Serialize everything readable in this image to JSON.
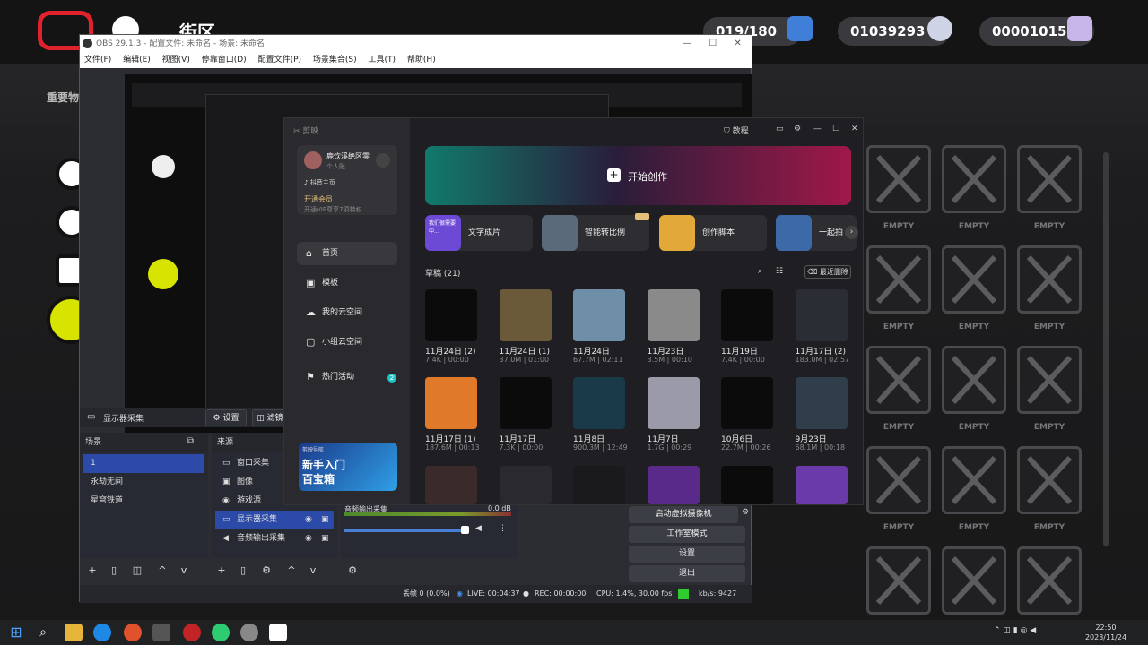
{
  "game": {
    "counter1": "019/180",
    "counter2": "01039293",
    "counter3": "00001015",
    "label": "重要物",
    "empty_label": "EMPTY",
    "empties": [
      "EMPTY",
      "EMPTY",
      "EMPTY",
      "EMPTY",
      "EMPTY",
      "EMPTY",
      "EMPTY",
      "EMPTY",
      "EMPTY",
      "EMPTY",
      "EMPTY",
      "EMPTY",
      "EMPTY",
      "EMPTY",
      "EMPTY"
    ]
  },
  "obs": {
    "title": "OBS 29.1.3 - 配置文件: 未命名 - 场景: 未命名",
    "menu": [
      "文件(F)",
      "编辑(E)",
      "视图(V)",
      "停靠窗口(D)",
      "配置文件(P)",
      "场景集合(S)",
      "工具(T)",
      "帮助(H)"
    ],
    "source_name": "显示器采集",
    "settings_btn": "设置",
    "filters_btn": "滤镜",
    "scenes_header": "场景",
    "sources_header": "来源",
    "scenes": [
      "1",
      "永劫无间",
      "星穹铁道"
    ],
    "sources": [
      "窗口采集",
      "图像",
      "游戏源",
      "显示器采集",
      "音频输出采集"
    ],
    "mixer_label": "音频输出采集",
    "mixer_db": "0.0 dB",
    "controls": [
      "启动虚拟摄像机",
      "工作室模式",
      "设置",
      "退出"
    ],
    "status": {
      "dropped": "丢帧 0 (0.0%)",
      "live": "LIVE: 00:04:37",
      "rec": "REC: 00:00:00",
      "cpu": "CPU: 1.4%, 30.00 fps",
      "kbps": "kb/s: 9427"
    }
  },
  "jy": {
    "app_name": "剪映",
    "tutorial": "教程",
    "user_name": "鹿饮溪绝区零",
    "user_type": "个人账",
    "douyin_home": "抖音主页",
    "vip_title": "开通会员",
    "vip_sub": "开通VIP尊享7项特权",
    "nav": [
      "首页",
      "模板",
      "我的云空间",
      "小组云空间",
      "热门活动"
    ],
    "nav_badge": "2",
    "banner_caption": "剪映导航",
    "banner_title": "新手入门",
    "banner_sub": "百宝箱",
    "create": "开始创作",
    "quick_tools": [
      "文字成片",
      "智能转比例",
      "创作脚本",
      "一起拍"
    ],
    "quick_tool_thumb": "我们很需要中...",
    "drafts_title": "草稿 (21)",
    "recycle": "最近删除",
    "drafts": [
      {
        "name": "11月24日 (2)",
        "meta": "7.4K | 00:00"
      },
      {
        "name": "11月24日 (1)",
        "meta": "37.0M | 01:00"
      },
      {
        "name": "11月24日",
        "meta": "67.7M | 02:11"
      },
      {
        "name": "11月23日",
        "meta": "3.5M | 00:10"
      },
      {
        "name": "11月19日",
        "meta": "7.4K | 00:00"
      },
      {
        "name": "11月17日 (2)",
        "meta": "183.0M | 02:57"
      },
      {
        "name": "11月17日 (1)",
        "meta": "187.6M | 00:13"
      },
      {
        "name": "11月17日",
        "meta": "7.3K | 00:00"
      },
      {
        "name": "11月8日",
        "meta": "900.3M | 12:49"
      },
      {
        "name": "11月7日",
        "meta": "1.7G | 00:29"
      },
      {
        "name": "10月6日",
        "meta": "22.7M | 00:26"
      },
      {
        "name": "9月23日",
        "meta": "68.1M | 00:18"
      }
    ]
  },
  "taskbar": {
    "time": "22:50",
    "date": "2023/11/24"
  }
}
